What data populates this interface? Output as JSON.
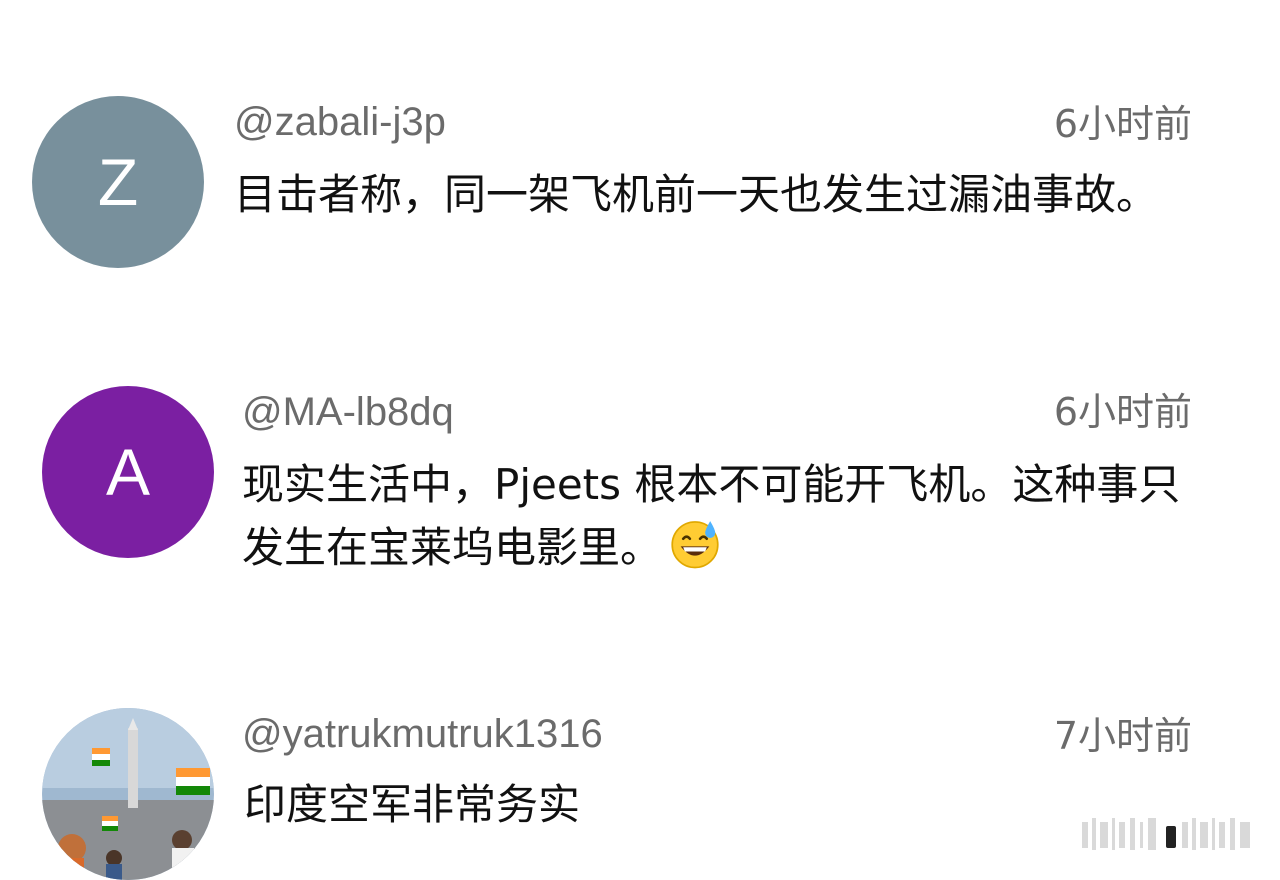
{
  "comments": [
    {
      "avatar_letter": "Z",
      "avatar_color": "#78909c",
      "handle": "@zabali-j3p",
      "time": "6小时前",
      "text": "目击者称，同一架飞机前一天也发生过漏油事故。"
    },
    {
      "avatar_letter": "A",
      "avatar_color": "#7b1fa2",
      "handle": "@MA-lb8dq",
      "time": "6小时前",
      "text": "现实生活中，Pjeets 根本不可能开飞机。这种事只发生在宝莱坞电影里。",
      "emoji": "grinning-face-with-sweat"
    },
    {
      "avatar_kind": "photo",
      "handle": "@yatrukmutruk1316",
      "time": "7小时前",
      "text": "印度空军非常务实"
    }
  ]
}
